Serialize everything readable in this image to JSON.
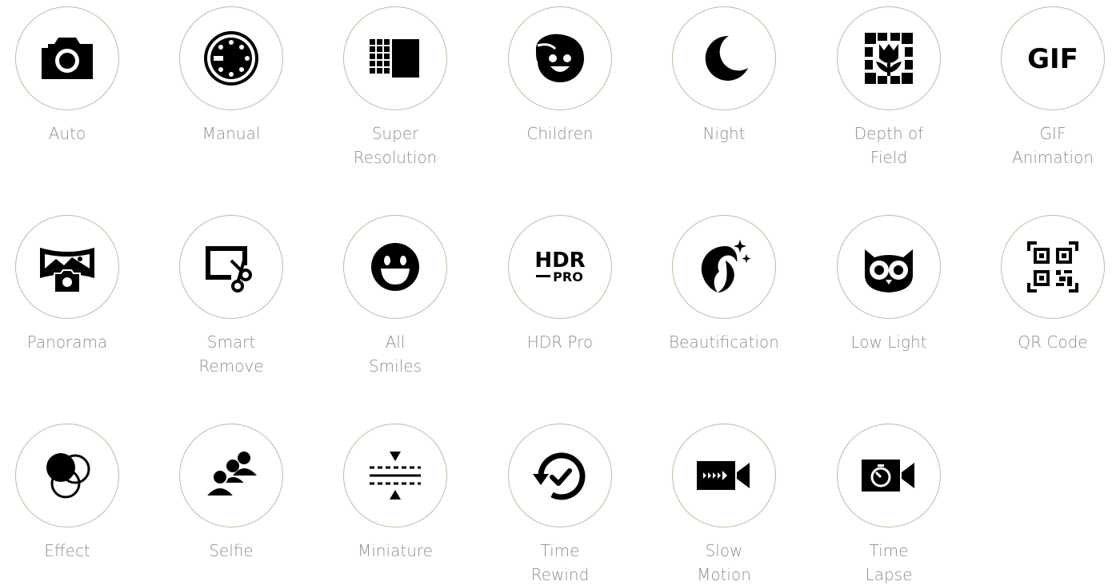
{
  "modes": [
    {
      "icon": "camera-icon",
      "label": [
        "Auto"
      ]
    },
    {
      "icon": "manual-dial-icon",
      "label": [
        "Manual"
      ]
    },
    {
      "icon": "super-resolution-icon",
      "label": [
        "Super",
        "Resolution"
      ]
    },
    {
      "icon": "child-face-icon",
      "label": [
        "Children"
      ]
    },
    {
      "icon": "moon-icon",
      "label": [
        "Night"
      ]
    },
    {
      "icon": "flower-frame-icon",
      "label": [
        "Depth of",
        "Field"
      ]
    },
    {
      "icon": "gif-icon",
      "label": [
        "GIF",
        "Animation"
      ],
      "icon_text": "GIF"
    },
    {
      "icon": "panorama-icon",
      "label": [
        "Panorama"
      ]
    },
    {
      "icon": "scissors-frame-icon",
      "label": [
        "Smart",
        "Remove"
      ]
    },
    {
      "icon": "smiley-icon",
      "label": [
        "All",
        "Smiles"
      ]
    },
    {
      "icon": "hdr-pro-icon",
      "label": [
        "HDR Pro"
      ],
      "icon_text": [
        "HDR",
        "PRO"
      ]
    },
    {
      "icon": "beauty-face-icon",
      "label": [
        "Beautification"
      ]
    },
    {
      "icon": "owl-icon",
      "label": [
        "Low Light"
      ]
    },
    {
      "icon": "qr-code-icon",
      "label": [
        "QR Code"
      ]
    },
    {
      "icon": "overlap-circles-icon",
      "label": [
        "Effect"
      ]
    },
    {
      "icon": "group-selfie-icon",
      "label": [
        "Selfie"
      ]
    },
    {
      "icon": "tilt-shift-icon",
      "label": [
        "Miniature"
      ]
    },
    {
      "icon": "rewind-check-icon",
      "label": [
        "Time",
        "Rewind"
      ]
    },
    {
      "icon": "slow-motion-video-icon",
      "label": [
        "Slow",
        "Motion"
      ]
    },
    {
      "icon": "timelapse-video-icon",
      "label": [
        "Time",
        "Lapse"
      ]
    }
  ],
  "colors": {
    "ring_border": "#c9b79c",
    "label": "#8e8e8e",
    "icon": "#000000"
  }
}
